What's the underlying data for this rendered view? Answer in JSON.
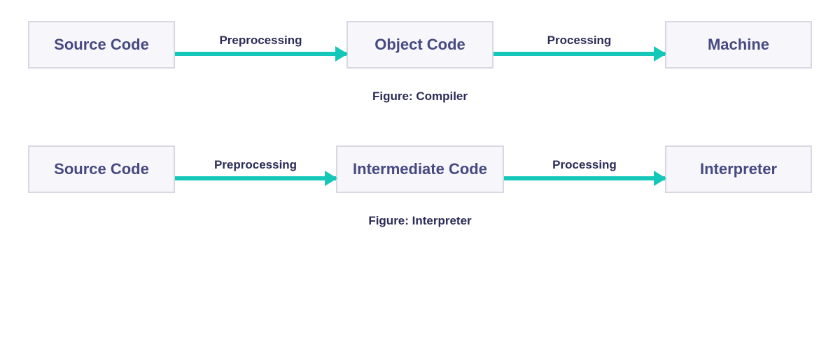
{
  "diagrams": [
    {
      "nodes": [
        "Source Code",
        "Object Code",
        "Machine"
      ],
      "edges": [
        "Preprocessing",
        "Processing"
      ],
      "caption": "Figure: Compiler"
    },
    {
      "nodes": [
        "Source Code",
        "Intermediate Code",
        "Interpreter"
      ],
      "edges": [
        "Preprocessing",
        "Processing"
      ],
      "caption": "Figure: Interpreter"
    }
  ],
  "colors": {
    "node_bg": "#f6f6fb",
    "node_border": "#d7d8e2",
    "node_text": "#474a80",
    "arrow": "#14c7b8",
    "label": "#2b2c57"
  }
}
